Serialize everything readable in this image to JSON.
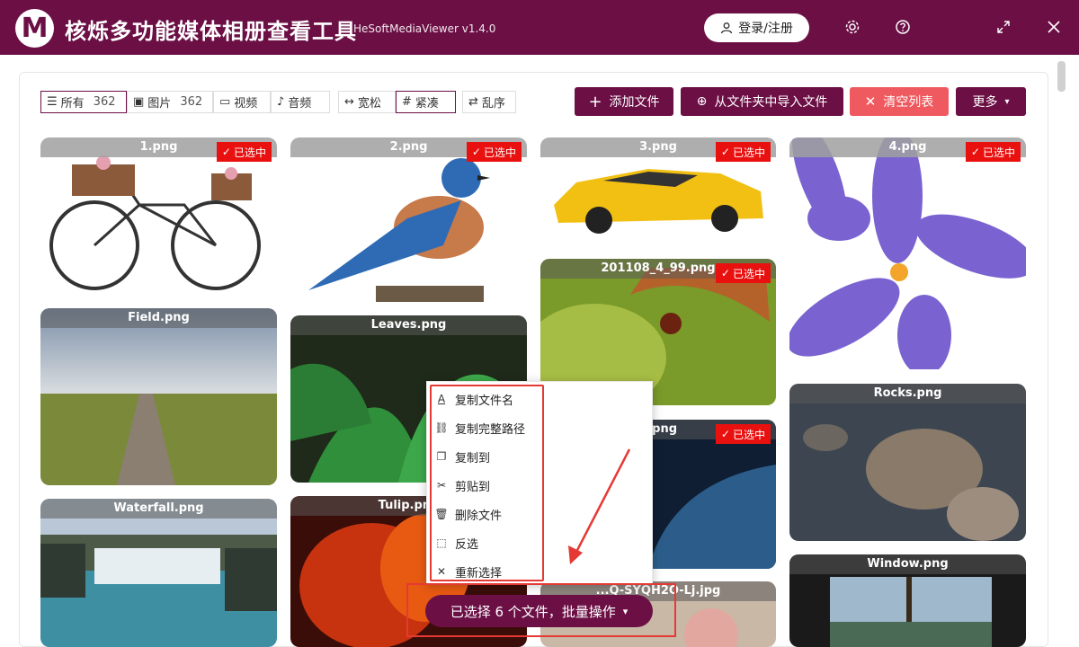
{
  "app": {
    "logo_letter": "M",
    "title": "核烁多功能媒体相册查看工具",
    "subtitle": "HeSoftMediaViewer v1.4.0",
    "login_label": "登录/注册",
    "accent": "#6b0f45"
  },
  "titlebar_icons": [
    "gear-icon",
    "help-icon",
    "maximize-icon",
    "close-icon"
  ],
  "filters": [
    {
      "label": "所有",
      "count": "362",
      "icon": "list-icon",
      "active": true
    },
    {
      "label": "图片",
      "count": "362",
      "icon": "image-icon"
    },
    {
      "label": "视频",
      "icon": "video-icon"
    },
    {
      "label": "音频",
      "icon": "mic-icon"
    }
  ],
  "layout_modes": [
    {
      "label": "宽松",
      "icon": "loose-icon"
    },
    {
      "label": "紧凑",
      "icon": "grid-icon",
      "active": true
    }
  ],
  "shuffle_label": "乱序",
  "actions": {
    "add": "添加文件",
    "import": "从文件夹中导入文件",
    "clear": "清空列表",
    "more": "更多"
  },
  "selected_badge": "已选中",
  "cards": [
    {
      "name": "1.png",
      "selected": true
    },
    {
      "name": "2.png",
      "selected": true
    },
    {
      "name": "3.png",
      "selected": true
    },
    {
      "name": "4.png",
      "selected": true
    },
    {
      "name": "Field.png",
      "selected": false
    },
    {
      "name": "Leaves.png",
      "selected": false
    },
    {
      "name": "201108_4_99.png",
      "selected": true
    },
    {
      "name": "g.png",
      "selected": true
    },
    {
      "name": "Rocks.png",
      "selected": false
    },
    {
      "name": "Waterfall.png",
      "selected": false
    },
    {
      "name": "Tulip.png",
      "selected": false
    },
    {
      "name": "...Q-SYQH2O-Lj.jpg",
      "selected": false
    },
    {
      "name": "Window.png",
      "selected": false
    }
  ],
  "context_menu": [
    {
      "label": "复制文件名",
      "icon": "text-icon"
    },
    {
      "label": "复制完整路径",
      "icon": "link-icon"
    },
    {
      "label": "复制到",
      "icon": "copy-icon"
    },
    {
      "label": "剪贴到",
      "icon": "scissors-icon"
    },
    {
      "label": "删除文件",
      "icon": "trash-icon"
    },
    {
      "label": "反选",
      "icon": "select-icon"
    },
    {
      "label": "重新选择",
      "icon": "x-icon"
    }
  ],
  "batch": {
    "label": "已选择 6 个文件，批量操作"
  }
}
